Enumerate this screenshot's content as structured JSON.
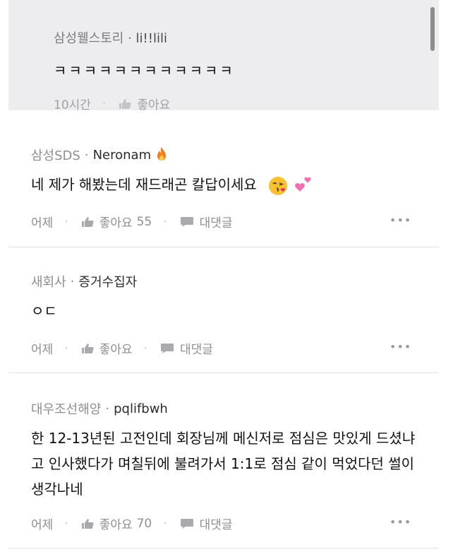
{
  "reply": {
    "company": "삼성웰스토리",
    "username": "li!!lili",
    "text": "ㅋㅋㅋㅋㅋㅋㅋㅋㅋㅋㅋㅋ",
    "time": "10시간",
    "like_label": "좋아요"
  },
  "comments": [
    {
      "company": "삼성SDS",
      "username": "Neronam",
      "username_icon": "fire-emoji",
      "text": "네 제가 해봤는데 재드래곤 칼답이세요",
      "text_icons": [
        "kissing-face-emoji",
        "two-hearts-emoji"
      ],
      "time": "어제",
      "like_label": "좋아요",
      "like_count": "55",
      "reply_label": "대댓글",
      "more": "•••"
    },
    {
      "company": "새회사",
      "username": "증거수집자",
      "text": "ㅇㄷ",
      "time": "어제",
      "like_label": "좋아요",
      "like_count": "",
      "reply_label": "대댓글",
      "more": "•••"
    },
    {
      "company": "대우조선해양",
      "username": "pqlifbwh",
      "text": "한 12-13년된 고전인데 회장님께 메신저로 점심은 맛있게 드셨냐고 인사했다가 며칠뒤에 불려가서 1:1로 점심 같이 먹었다던 썰이 생각나네",
      "time": "어제",
      "like_label": "좋아요",
      "like_count": "70",
      "reply_label": "대댓글",
      "more": "•••"
    }
  ]
}
